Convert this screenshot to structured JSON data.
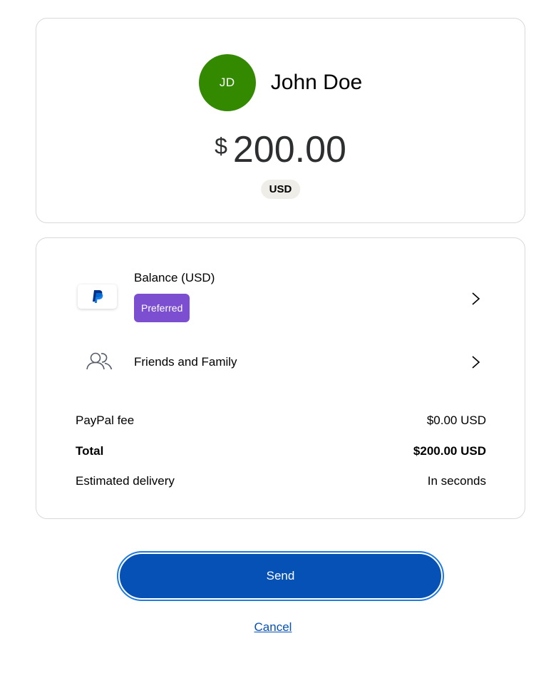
{
  "recipient": {
    "initials": "JD",
    "name": "John Doe",
    "avatar_color": "#338a00"
  },
  "amount": {
    "symbol": "$",
    "value": "200.00",
    "currency": "USD"
  },
  "payment_method": {
    "icon": "paypal-logo-icon",
    "label": "Balance (USD)",
    "badge": "Preferred",
    "badge_color": "#7b4fcf"
  },
  "transfer_type": {
    "icon": "people-icon",
    "label": "Friends and Family"
  },
  "summary": {
    "fee_label": "PayPal fee",
    "fee_value": "$0.00 USD",
    "total_label": "Total",
    "total_value": "$200.00 USD",
    "delivery_label": "Estimated delivery",
    "delivery_value": "In seconds"
  },
  "actions": {
    "send_label": "Send",
    "cancel_label": "Cancel",
    "primary_color": "#0551b5"
  }
}
